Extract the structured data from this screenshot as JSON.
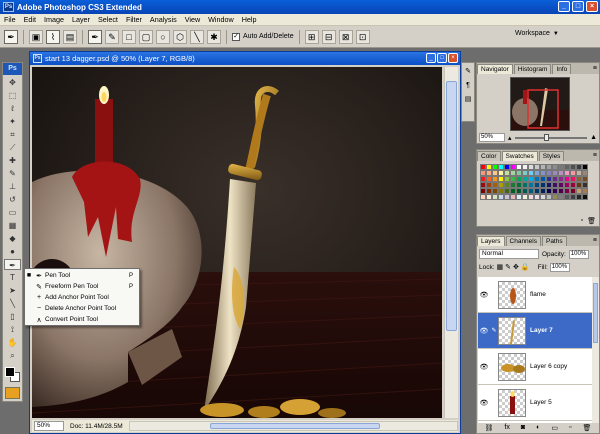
{
  "app": {
    "title": "Adobe Photoshop CS3 Extended",
    "logo": "Ps",
    "window_controls": [
      "_",
      "□",
      "×"
    ]
  },
  "menu": [
    "File",
    "Edit",
    "Image",
    "Layer",
    "Select",
    "Filter",
    "Analysis",
    "View",
    "Window",
    "Help"
  ],
  "options_bar": {
    "auto_add_delete_label": "Auto Add/Delete",
    "auto_add_delete_checked": true,
    "workspace_label": "Workspace"
  },
  "document": {
    "title": "start 13 dagger.psd @ 50% (Layer 7, RGB/8)",
    "zoom": "50%",
    "doc_info": "Doc: 11.4M/28.5M"
  },
  "tool_flyout": {
    "items": [
      {
        "label": "Pen Tool",
        "shortcut": "P",
        "selected": true
      },
      {
        "label": "Freeform Pen Tool",
        "shortcut": "P",
        "selected": false
      },
      {
        "label": "Add Anchor Point Tool",
        "shortcut": "",
        "selected": false
      },
      {
        "label": "Delete Anchor Point Tool",
        "shortcut": "",
        "selected": false
      },
      {
        "label": "Convert Point Tool",
        "shortcut": "",
        "selected": false
      }
    ]
  },
  "navigator_panel": {
    "tabs": [
      "Navigator",
      "Histogram",
      "Info"
    ],
    "active_tab": "Navigator",
    "zoom": "50%"
  },
  "swatches_panel": {
    "tabs": [
      "Color",
      "Swatches",
      "Styles"
    ],
    "active_tab": "Swatches",
    "colors": [
      "#ff0000",
      "#ffff00",
      "#00ff00",
      "#00ffff",
      "#0000ff",
      "#ff00ff",
      "#ffffff",
      "#f2f2f2",
      "#dddddd",
      "#c8c8c8",
      "#b4b4b4",
      "#a0a0a0",
      "#8c8c8c",
      "#787878",
      "#646464",
      "#505050",
      "#3c3c3c",
      "#000000",
      "#f7977a",
      "#f9ad81",
      "#fdc68a",
      "#fff79a",
      "#c4df9b",
      "#a3d39c",
      "#82ca9d",
      "#7bcdc8",
      "#6ecff6",
      "#7ea7d8",
      "#8493ca",
      "#8882be",
      "#a187be",
      "#bc8dbf",
      "#f49ac2",
      "#f6989d",
      "#c7b299",
      "#998675",
      "#ed1c24",
      "#f26522",
      "#f7941d",
      "#fff200",
      "#8dc63f",
      "#39b54a",
      "#00a651",
      "#00a99d",
      "#00aeef",
      "#0072bc",
      "#0054a6",
      "#2e3192",
      "#662d91",
      "#92278f",
      "#ec008c",
      "#ed145b",
      "#8c6239",
      "#754c24",
      "#9e0b0f",
      "#a0410d",
      "#a36209",
      "#aba000",
      "#598527",
      "#1a7b30",
      "#007236",
      "#00746b",
      "#0076a3",
      "#004a80",
      "#003471",
      "#1b1464",
      "#440e62",
      "#630460",
      "#9e005d",
      "#9e0039",
      "#603913",
      "#362f2d",
      "#790000",
      "#7b2e00",
      "#7d4900",
      "#827b00",
      "#406618",
      "#005e20",
      "#005826",
      "#005952",
      "#005b7f",
      "#003663",
      "#002157",
      "#0d004c",
      "#32004b",
      "#4b0049",
      "#7b0046",
      "#7a0026",
      "#c69c6d",
      "#a67c52",
      "#fbd5b5",
      "#fde9d9",
      "#d6e3bc",
      "#c6d9f1",
      "#ccc1d9",
      "#e5b9b7",
      "#dbeef3",
      "#ebf1de",
      "#f2dcdb",
      "#e5e0ec",
      "#d9d9d9",
      "#bfbfbf",
      "#948a54",
      "#7f7f7f",
      "#595959",
      "#404040",
      "#262626",
      "#0d0d0d"
    ]
  },
  "layers_panel": {
    "tabs": [
      "Layers",
      "Channels",
      "Paths"
    ],
    "active_tab": "Layers",
    "blend_mode": "Normal",
    "opacity_label": "Opacity:",
    "opacity": "100%",
    "lock_label": "Lock:",
    "fill_label": "Fill:",
    "fill": "100%",
    "layers": [
      {
        "name": "flame",
        "visible": true,
        "selected": false
      },
      {
        "name": "Layer 7",
        "visible": true,
        "selected": true
      },
      {
        "name": "Layer 6 copy",
        "visible": true,
        "selected": false
      },
      {
        "name": "Layer 5",
        "visible": true,
        "selected": false
      }
    ]
  },
  "icons": {
    "layer_footer": [
      "link-icon",
      "fx-icon",
      "mask-icon",
      "adjustment-icon",
      "folder-icon",
      "new-layer-icon",
      "trash-icon"
    ]
  }
}
